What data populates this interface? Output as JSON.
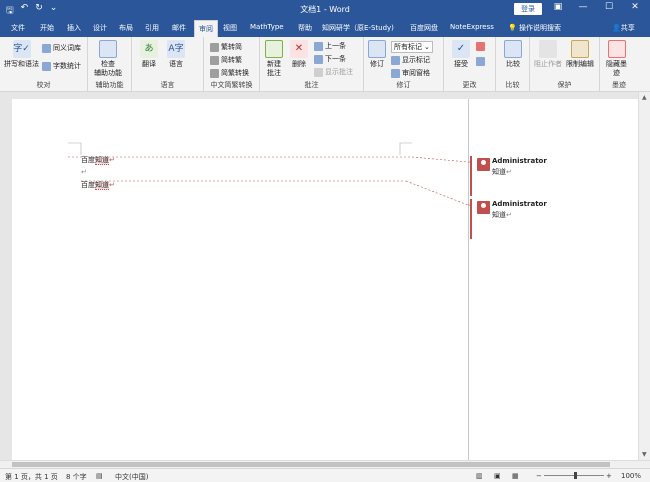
{
  "title": "文档1 - Word",
  "login_label": "登录",
  "tabs": [
    "文件",
    "开始",
    "插入",
    "设计",
    "布局",
    "引用",
    "邮件",
    "审阅",
    "视图",
    "MathType",
    "帮助",
    "知网研学（原E-Study)",
    "百度网盘",
    "NoteExpress"
  ],
  "active_tab": "审阅",
  "tell_me": "操作说明搜索",
  "share": "共享",
  "ribbon": {
    "proofing": {
      "label": "校对",
      "spelling": "拼写和语法",
      "thesaurus": "同义词库",
      "word_count": "字数统计"
    },
    "accessibility": {
      "label": "辅助功能",
      "check": "检查",
      "check2": "辅助功能"
    },
    "language": {
      "label": "语言",
      "translate": "翻译",
      "language": "语言"
    },
    "chinese_conv": {
      "label": "中文简繁转换",
      "to_simplified": "繁转简",
      "to_traditional": "简转繁",
      "convert": "简繁转换"
    },
    "comments": {
      "label": "批注",
      "new": "新建",
      "new2": "批注",
      "delete": "删除",
      "prev": "上一条",
      "next": "下一条",
      "show": "显示批注"
    },
    "tracking": {
      "label": "修订",
      "track": "修订",
      "markup_select": "所有标记",
      "show_markup": "显示标记",
      "review_pane": "审阅窗格"
    },
    "changes": {
      "label": "更改",
      "accept": "接受"
    },
    "compare": {
      "label": "比较",
      "compare": "比较"
    },
    "protect": {
      "label": "保护",
      "block_authors": "阻止作者",
      "restrict": "限制编辑"
    },
    "ink": {
      "label": "墨迹",
      "hide_ink": "隐藏墨",
      "hide_ink2": "迹"
    }
  },
  "document": {
    "lines": [
      "百度",
      "知道",
      "百度",
      "知道"
    ]
  },
  "comments": [
    {
      "author": "Administrator",
      "text": "知道"
    },
    {
      "author": "Administrator",
      "text": "知道"
    }
  ],
  "status": {
    "page": "第 1 页，共 1 页",
    "words": "8 个字",
    "lang": "中文(中国)",
    "zoom": "100%"
  }
}
